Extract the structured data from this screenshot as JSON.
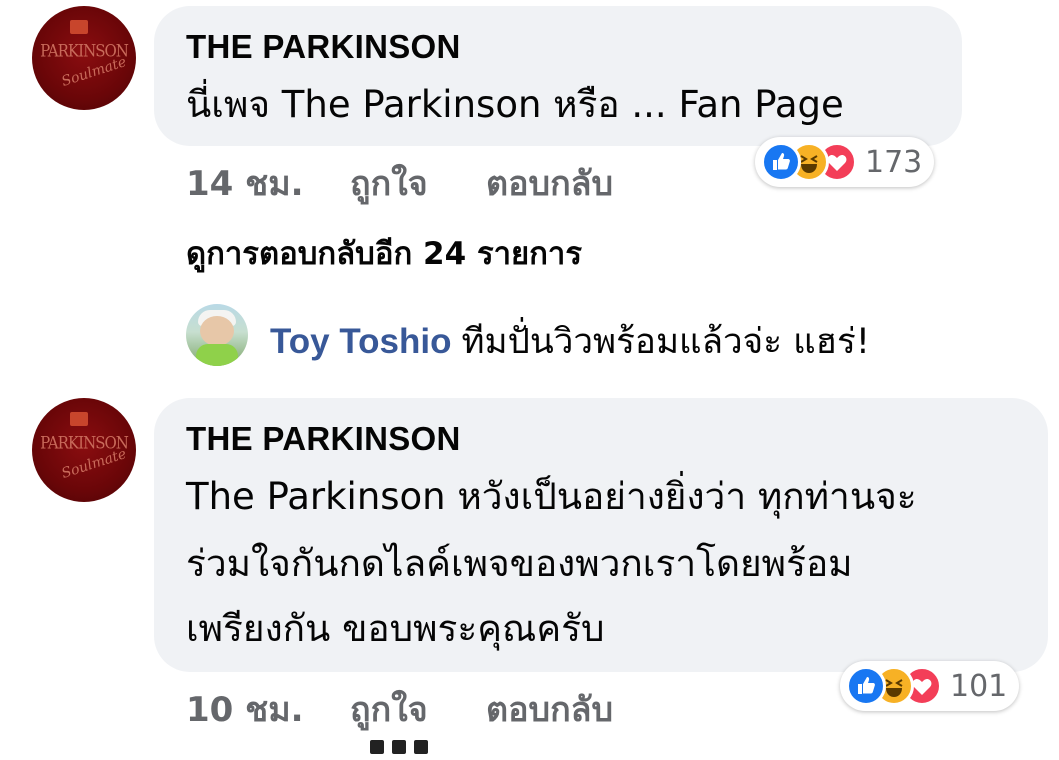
{
  "comments": [
    {
      "author": "THE PARKINSON",
      "text_lines": [
        "นี่เพจ The Parkinson หรือ ... Fan Page"
      ],
      "time": "14 ชม.",
      "like_label": "ถูกใจ",
      "reply_label": "ตอบกลับ",
      "reaction_count": "173",
      "reaction_icons": [
        "like-icon",
        "haha-icon",
        "love-icon"
      ],
      "more_replies": "ดูการตอบกลับอีก 24 รายการ",
      "reply_preview": {
        "author": "Toy Toshio",
        "text": "ทีมปั่นวิวพร้อมแล้วจ่ะ แฮร่!"
      }
    },
    {
      "author": "THE PARKINSON",
      "text_lines": [
        "The Parkinson หวังเป็นอย่างยิ่งว่า ทุกท่านจะ",
        "ร่วมใจกันกดไลค์เพจของพวกเราโดยพร้อม",
        "เพรียงกัน ขอบพระคุณครับ"
      ],
      "time": "10 ชม.",
      "like_label": "ถูกใจ",
      "reply_label": "ตอบกลับ",
      "reaction_count": "101",
      "reaction_icons": [
        "like-icon",
        "haha-icon",
        "love-icon"
      ]
    }
  ],
  "colors": {
    "bubble": "#f0f2f5",
    "meta_text": "#65676b",
    "like": "#1877f2",
    "haha": "#f7b125",
    "love": "#f33e58"
  }
}
